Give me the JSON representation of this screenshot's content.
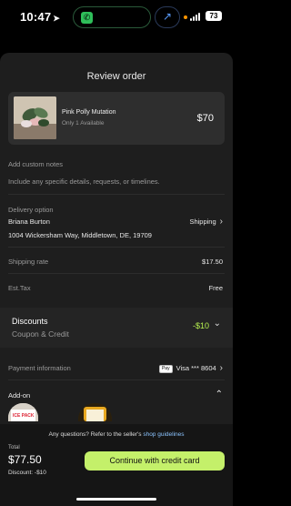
{
  "status_bar": {
    "time": "10:47",
    "battery": "73"
  },
  "header": {
    "title": "Review order"
  },
  "product": {
    "name": "Pink Polly Mutation",
    "availability": "Only 1 Available",
    "price": "$70"
  },
  "notes": {
    "label": "Add custom notes",
    "placeholder": "Include any specific details, requests, or timelines."
  },
  "delivery": {
    "label": "Delivery option",
    "name": "Briana Burton",
    "address": "1004 Wickersham Way, Middletown, DE, 19709",
    "method": "Shipping"
  },
  "costs": {
    "shipping_label": "Shipping rate",
    "shipping_value": "$17.50",
    "tax_label": "Est.Tax",
    "tax_value": "Free"
  },
  "discounts": {
    "title": "Discounts",
    "subtitle": "Coupon & Credit",
    "value": "-$10"
  },
  "payment": {
    "label": "Payment information",
    "badge": "Pay",
    "card": "Visa *** 8604"
  },
  "addon": {
    "label": "Add-on",
    "item1_text": "ICE PACK"
  },
  "footer": {
    "question": "Any questions? Refer to the seller's",
    "link": "shop guidelines",
    "total_label": "Total",
    "total_value": "$77.50",
    "discount_text": "Discount: -$10",
    "cta_label": "Continue with credit card"
  },
  "colors": {
    "accent": "#c4f06a",
    "discount": "#b6f04f",
    "link": "#8cc4ff"
  }
}
